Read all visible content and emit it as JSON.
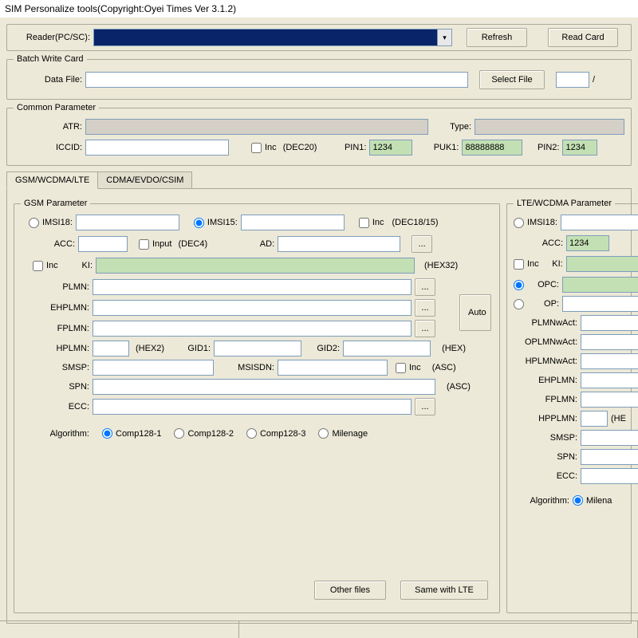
{
  "title": "SIM Personalize tools(Copyright:Oyei Times Ver 3.1.2)",
  "header": {
    "reader_label": "Reader(PC/SC):",
    "reader_value": "",
    "refresh": "Refresh",
    "read_card": "Read Card"
  },
  "batch": {
    "legend": "Batch Write Card",
    "data_file_label": "Data File:",
    "data_file_value": "",
    "select_file": "Select File",
    "sep": "/"
  },
  "common": {
    "legend": "Common Parameter",
    "atr_label": "ATR:",
    "atr_value": "",
    "type_label": "Type:",
    "type_value": "",
    "iccid_label": "ICCID:",
    "iccid_value": "",
    "inc_label": "Inc",
    "dec20": "(DEC20)",
    "pin1_label": "PIN1:",
    "pin1_value": "1234",
    "puk1_label": "PUK1:",
    "puk1_value": "88888888",
    "pin2_label": "PIN2:",
    "pin2_value": "1234"
  },
  "tabs": {
    "gsm": "GSM/WCDMA/LTE",
    "cdma": "CDMA/EVDO/CSIM"
  },
  "gsm": {
    "legend": "GSM Parameter",
    "imsi18": "IMSI18:",
    "imsi15": "IMSI15:",
    "inc": "Inc",
    "dec1815": "(DEC18/15)",
    "acc": "ACC:",
    "input": "Input",
    "dec4": "(DEC4)",
    "ad": "AD:",
    "browse": "...",
    "ki": "KI:",
    "hex32": "(HEX32)",
    "plmn": "PLMN:",
    "auto": "Auto",
    "ehplmn": "EHPLMN:",
    "fplmn": "FPLMN:",
    "hplmn": "HPLMN:",
    "hex2": "(HEX2)",
    "gid1": "GID1:",
    "gid2": "GID2:",
    "hex": "(HEX)",
    "smsp": "SMSP:",
    "msisdn": "MSISDN:",
    "asc": "(ASC)",
    "spn": "SPN:",
    "ecc": "ECC:",
    "algorithm": "Algorithm:",
    "comp1": "Comp128-1",
    "comp2": "Comp128-2",
    "comp3": "Comp128-3",
    "milenage": "Milenage",
    "other_files": "Other files",
    "same_lte": "Same with LTE"
  },
  "lte": {
    "legend": "LTE/WCDMA Parameter",
    "imsi18": "IMSI18:",
    "acc": "ACC:",
    "acc_value": "1234",
    "inc": "Inc",
    "ki": "KI:",
    "opc": "OPC:",
    "op": "OP:",
    "plmnwact": "PLMNwAct:",
    "oplmnwact": "OPLMNwAct:",
    "hplmnwact": "HPLMNwAct:",
    "ehplmn": "EHPLMN:",
    "fplmn": "FPLMN:",
    "hpplmn": "HPPLMN:",
    "hex": "(HE",
    "smsp": "SMSP:",
    "spn": "SPN:",
    "ecc": "ECC:",
    "algorithm": "Algorithm:",
    "milenage": "Milena"
  }
}
